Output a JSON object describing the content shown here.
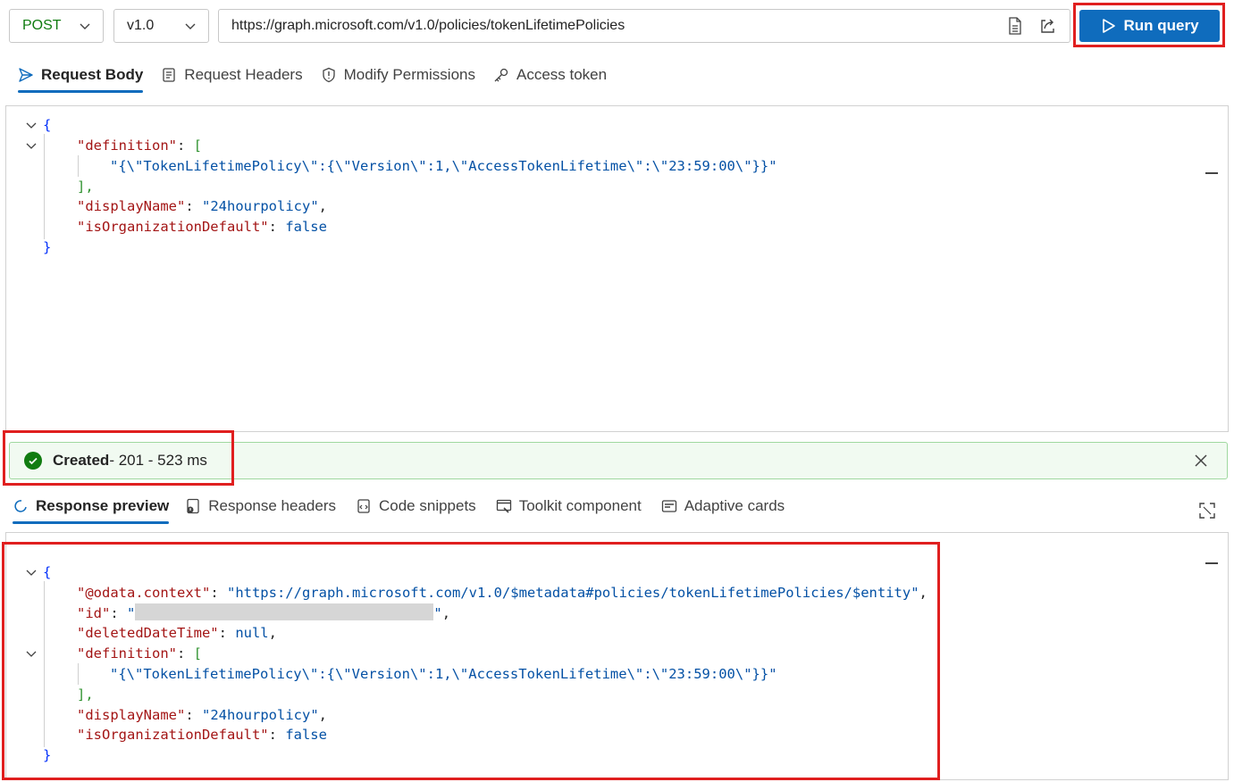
{
  "toolbar": {
    "method": "POST",
    "version": "v1.0",
    "url": "https://graph.microsoft.com/v1.0/policies/tokenLifetimePolicies",
    "run_label": "Run query"
  },
  "request_tabs": [
    {
      "label": "Request Body",
      "active": true
    },
    {
      "label": "Request Headers"
    },
    {
      "label": "Modify Permissions"
    },
    {
      "label": "Access token"
    }
  ],
  "request_body": {
    "brace_open": "{",
    "definition_key": "\"definition\"",
    "open_bracket": "[",
    "definition_value": "\"{\\\"TokenLifetimePolicy\\\":{\\\"Version\\\":1,\\\"AccessTokenLifetime\\\":\\\"23:59:00\\\"}}\"",
    "close_bracket": "],",
    "display_name_key": "\"displayName\"",
    "display_name_value": "\"24hourpolicy\"",
    "is_default_key": "\"isOrganizationDefault\"",
    "is_default_value": "false",
    "brace_close": "}"
  },
  "status": {
    "state": "Created",
    "detail": " - 201 - 523 ms",
    "color": "#107c10"
  },
  "response_tabs": [
    {
      "label": "Response preview",
      "active": true
    },
    {
      "label": "Response headers"
    },
    {
      "label": "Code snippets"
    },
    {
      "label": "Toolkit component"
    },
    {
      "label": "Adaptive cards"
    }
  ],
  "response_body": {
    "brace_open": "{",
    "context_key": "\"@odata.context\"",
    "context_value": "\"https://graph.microsoft.com/v1.0/$metadata#policies/tokenLifetimePolicies/$entity\"",
    "id_key": "\"id\"",
    "deleted_key": "\"deletedDateTime\"",
    "deleted_value": "null",
    "definition_key": "\"definition\"",
    "open_bracket": "[",
    "definition_value": "\"{\\\"TokenLifetimePolicy\\\":{\\\"Version\\\":1,\\\"AccessTokenLifetime\\\":\\\"23:59:00\\\"}}\"",
    "close_bracket": "],",
    "display_name_key": "\"displayName\"",
    "display_name_value": "\"24hourpolicy\"",
    "is_default_key": "\"isOrganizationDefault\"",
    "is_default_value": "false",
    "brace_close": "}"
  },
  "colors": {
    "accent": "#0f6cbd",
    "highlight": "#e01f1f",
    "json_key": "#a31515",
    "json_string": "#0451a5"
  }
}
